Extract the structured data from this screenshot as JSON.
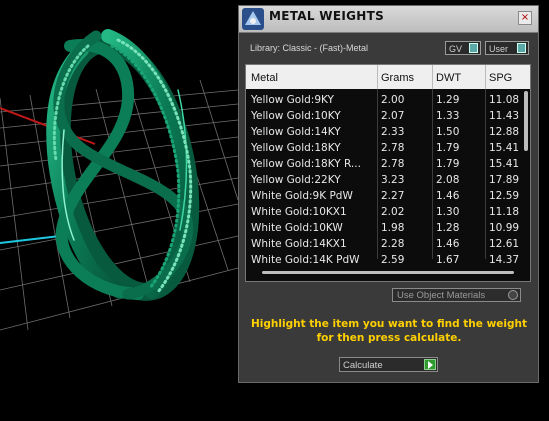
{
  "panel": {
    "title": "METAL WEIGHTS",
    "close_label": "×",
    "library_label": "Library: Classic - (Fast)-Metal",
    "gv_label": "GV",
    "user_label": "User"
  },
  "table": {
    "headers": {
      "metal": "Metal",
      "grams": "Grams",
      "dwt": "DWT",
      "spg": "SPG"
    },
    "rows": [
      {
        "metal": "Yellow Gold:9KY",
        "grams": "2.00",
        "dwt": "1.29",
        "spg": "11.08"
      },
      {
        "metal": "Yellow Gold:10KY",
        "grams": "2.07",
        "dwt": "1.33",
        "spg": "11.43"
      },
      {
        "metal": "Yellow Gold:14KY",
        "grams": "2.33",
        "dwt": "1.50",
        "spg": "12.88"
      },
      {
        "metal": "Yellow Gold:18KY",
        "grams": "2.78",
        "dwt": "1.79",
        "spg": "15.41"
      },
      {
        "metal": "Yellow Gold:18KY R...",
        "grams": "2.78",
        "dwt": "1.79",
        "spg": "15.41"
      },
      {
        "metal": "Yellow Gold:22KY",
        "grams": "3.23",
        "dwt": "2.08",
        "spg": "17.89"
      },
      {
        "metal": "White Gold:9K PdW",
        "grams": "2.27",
        "dwt": "1.46",
        "spg": "12.59"
      },
      {
        "metal": "White Gold:10KX1",
        "grams": "2.02",
        "dwt": "1.30",
        "spg": "11.18"
      },
      {
        "metal": "White Gold:10KW",
        "grams": "1.98",
        "dwt": "1.28",
        "spg": "10.99"
      },
      {
        "metal": "White Gold:14KX1",
        "grams": "2.28",
        "dwt": "1.46",
        "spg": "12.61"
      },
      {
        "metal": "White Gold:14K PdW",
        "grams": "2.59",
        "dwt": "1.67",
        "spg": "14.37"
      }
    ]
  },
  "options": {
    "use_object_materials": "Use Object Materials"
  },
  "hint": {
    "line1": "Highlight the item you want to find the weight",
    "line2": "for then press calculate."
  },
  "actions": {
    "calculate_label": "Calculate"
  },
  "colors": {
    "ring": "#0e8a62",
    "ring_highlight": "#3fd7a3",
    "hint": "#ffd000",
    "grid": "#6e6e6e"
  }
}
